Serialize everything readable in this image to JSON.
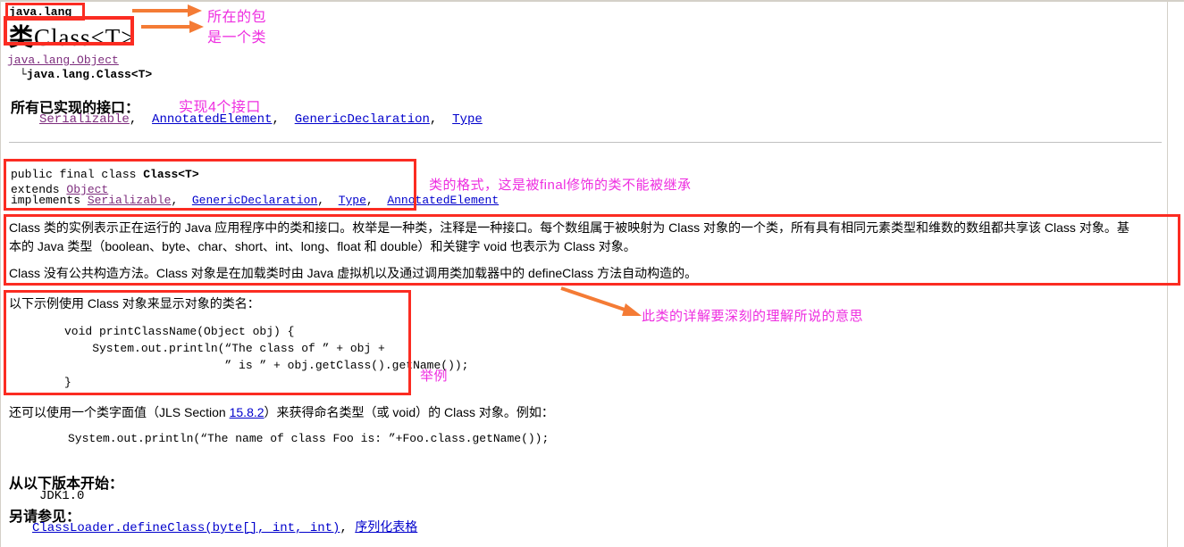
{
  "page": {
    "package_name": "java.lang",
    "class_title_prefix": "类",
    "class_title_name": "Class<T>",
    "hierarchy": {
      "root": "java.lang.Object",
      "branch_glyph": "└",
      "child": "java.lang.Class<T>"
    },
    "interfaces_heading": "所有已实现的接口：",
    "interfaces": [
      {
        "label": "Serializable",
        "visited": true
      },
      {
        "label": "AnnotatedElement",
        "visited": false
      },
      {
        "label": "GenericDeclaration",
        "visited": false
      },
      {
        "label": "Type",
        "visited": false
      }
    ],
    "declaration": {
      "line1_plain": "public final class ",
      "line1_bold": "Class<T>",
      "line2_keyword": "extends ",
      "line2_link": "Object",
      "line3_keyword": "implements ",
      "line3_links": [
        {
          "label": "Serializable",
          "visited": true
        },
        {
          "label": "GenericDeclaration",
          "visited": false
        },
        {
          "label": "Type",
          "visited": false
        },
        {
          "label": "AnnotatedElement",
          "visited": false
        }
      ]
    },
    "description": {
      "p1_line1": "Class 类的实例表示正在运行的 Java 应用程序中的类和接口。枚举是一种类，注释是一种接口。每个数组属于被映射为 Class 对象的一个类，所有具有相同元素类型和维数的数组都共享该 Class 对象。基",
      "p1_line2": "本的 Java 类型（boolean、byte、char、short、int、long、float 和 double）和关键字 void 也表示为 Class 对象。",
      "p2_line1": "Class 没有公共构造方法。Class 对象是在加载类时由 Java 虚拟机以及通过调用类加载器中的 defineClass 方法自动构造的。"
    },
    "example": {
      "intro": "以下示例使用 Class 对象来显示对象的类名：",
      "code_lines": [
        "void printClassName(Object obj) {",
        "    System.out.println(“The class of ” + obj +",
        "                       ” is ” + obj.getClass().getName());",
        "}"
      ]
    },
    "jls": {
      "prefix": "还可以使用一个类字面值（JLS Section ",
      "link": "15.8.2",
      "suffix": "）来获得命名类型（或 void）的 Class 对象。例如：",
      "code": "System.out.println(“The name of class Foo is: ”+Foo.class.getName());"
    },
    "since": {
      "heading": "从以下版本开始：",
      "value": "JDK1.0"
    },
    "see_also": {
      "heading": "另请参见：",
      "links": [
        {
          "label": "ClassLoader.defineClass(byte[], int, int)",
          "visited": false
        },
        {
          "label": "序列化表格",
          "visited": false
        }
      ],
      "separator": ", "
    }
  },
  "annotations": {
    "color": "#ee2ee0",
    "arrow_color": "#f47b35",
    "box_color": "#fb2c22",
    "items": [
      {
        "id": "pkg-note",
        "text": "所在的包"
      },
      {
        "id": "class-note",
        "text": "是一个类"
      },
      {
        "id": "iface-note",
        "text": "实现4个接口"
      },
      {
        "id": "decl-note",
        "text": "类的格式，这是被final修饰的类不能被继承"
      },
      {
        "id": "desc-note",
        "text": "此类的详解要深刻的理解所说的意思"
      },
      {
        "id": "example-note",
        "text": "举例"
      }
    ]
  }
}
